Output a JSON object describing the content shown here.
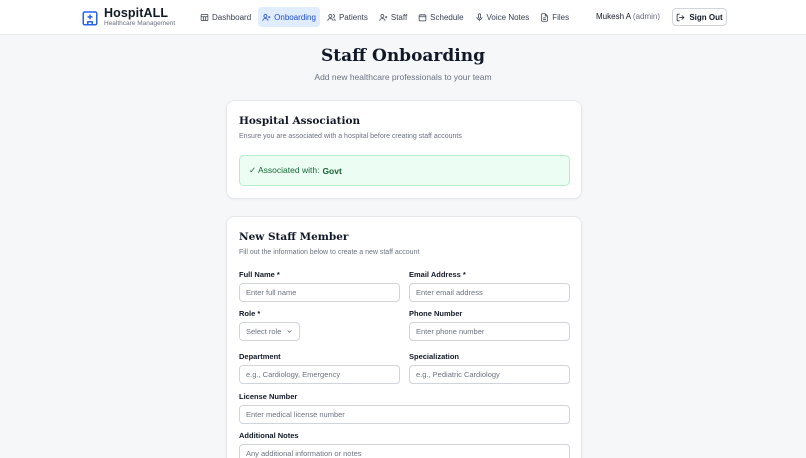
{
  "brand": {
    "name": "HospitALL",
    "subtitle": "Healthcare Management"
  },
  "nav": [
    {
      "label": "Dashboard",
      "icon": "dashboard-icon"
    },
    {
      "label": "Onboarding",
      "icon": "user-plus-icon",
      "active": true
    },
    {
      "label": "Patients",
      "icon": "users-icon"
    },
    {
      "label": "Staff",
      "icon": "user-plus-icon"
    },
    {
      "label": "Schedule",
      "icon": "calendar-icon"
    },
    {
      "label": "Voice Notes",
      "icon": "microphone-icon"
    },
    {
      "label": "Files",
      "icon": "file-icon"
    }
  ],
  "user": {
    "name": "Mukesh A",
    "role": "(admin)"
  },
  "signout_label": "Sign Out",
  "page": {
    "title": "Staff Onboarding",
    "subtitle": "Add new healthcare professionals to your team"
  },
  "hospital_card": {
    "title": "Hospital Association",
    "description": "Ensure you are associated with a hospital before creating staff accounts",
    "status_prefix": "✓ Associated with:",
    "hospital_name": "Govt"
  },
  "staff_card": {
    "title": "New Staff Member",
    "description": "Fill out the information below to create a new staff account",
    "fields": {
      "full_name": {
        "label": "Full Name *",
        "placeholder": "Enter full name"
      },
      "email": {
        "label": "Email Address *",
        "placeholder": "Enter email address"
      },
      "role": {
        "label": "Role *",
        "placeholder": "Select role"
      },
      "phone": {
        "label": "Phone Number",
        "placeholder": "Enter phone number"
      },
      "department": {
        "label": "Department",
        "placeholder": "e.g., Cardiology, Emergency"
      },
      "specialization": {
        "label": "Specialization",
        "placeholder": "e.g., Pediatric Cardiology"
      },
      "license": {
        "label": "License Number",
        "placeholder": "Enter medical license number"
      },
      "notes": {
        "label": "Additional Notes",
        "placeholder": "Any additional information or notes"
      }
    }
  },
  "colors": {
    "accent": "#1d4ed8",
    "active_bg": "#e0ecff",
    "success_bg": "#ecfdf3",
    "success_text": "#166534"
  }
}
